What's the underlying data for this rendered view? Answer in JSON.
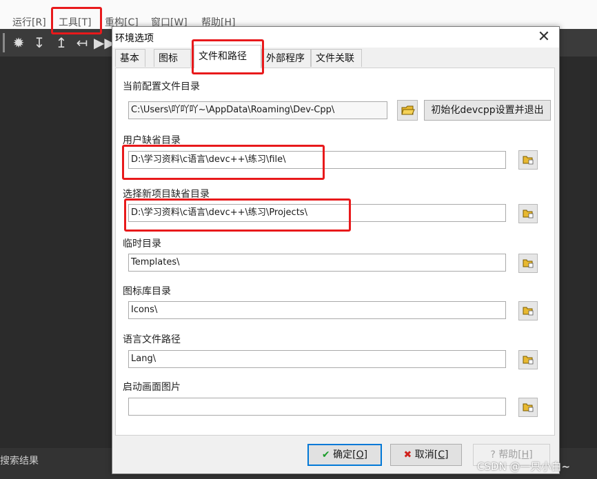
{
  "menubar": {
    "items": [
      "运行[R]",
      "工具[T]",
      "重构[C]",
      "窗口[W]",
      "帮助[H]"
    ]
  },
  "ide": {
    "search_results_label": "搜索结果"
  },
  "dialog": {
    "title": "环境选项",
    "tabs": [
      "基本",
      "图标",
      "文件和路径",
      "外部程序",
      "文件关联"
    ],
    "active_tab": "文件和路径",
    "fields": {
      "config_dir": {
        "label": "当前配置文件目录",
        "value": "C:\\Users\\吖吖吖~\\AppData\\Roaming\\Dev-Cpp\\"
      },
      "reset_button": "初始化devcpp设置并退出",
      "user_default_dir": {
        "label": "用户缺省目录",
        "value": "D:\\学习资料\\c语言\\devc++\\练习\\file\\"
      },
      "new_project_dir": {
        "label": "选择新项目缺省目录",
        "value": "D:\\学习资料\\c语言\\devc++\\练习\\Projects\\"
      },
      "temp_dir": {
        "label": "临时目录",
        "value": "Templates\\"
      },
      "icon_lib_dir": {
        "label": "图标库目录",
        "value": "Icons\\"
      },
      "lang_dir": {
        "label": "语言文件路径",
        "value": "Lang\\"
      },
      "splash_image": {
        "label": "启动画面图片",
        "value": ""
      }
    },
    "buttons": {
      "ok": {
        "label": "确定",
        "accel": "O"
      },
      "cancel": {
        "label": "取消",
        "accel": "C"
      },
      "help": {
        "label": "帮助",
        "accel": "H"
      }
    }
  },
  "watermark": "CSDN @一只小白~",
  "colors": {
    "annotation": "#e8191b",
    "ok_check": "#1a9c2a",
    "cancel_x": "#d0211c",
    "folder": "#e8b931"
  }
}
